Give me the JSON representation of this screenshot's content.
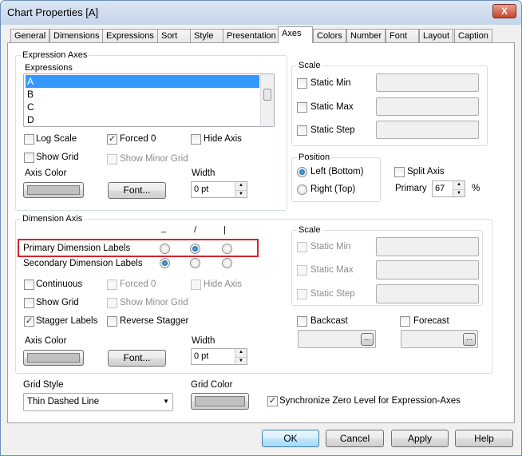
{
  "window": {
    "title": "Chart Properties [A]",
    "close": "X"
  },
  "tabs": [
    "General",
    "Dimensions",
    "Expressions",
    "Sort",
    "Style",
    "Presentation",
    "Axes",
    "Colors",
    "Number",
    "Font",
    "Layout",
    "Caption"
  ],
  "expression_axes": {
    "group_label": "Expression Axes",
    "list_label": "Expressions",
    "items": [
      "A",
      "B",
      "C",
      "D"
    ],
    "selected": "A",
    "log_scale": {
      "label": "Log Scale",
      "checked": false
    },
    "forced0": {
      "label": "Forced 0",
      "checked": true
    },
    "hide_axis": {
      "label": "Hide Axis",
      "checked": false
    },
    "show_grid": {
      "label": "Show Grid",
      "checked": false
    },
    "show_minor_grid": {
      "label": "Show Minor Grid",
      "checked": false,
      "disabled": true
    },
    "axis_color_label": "Axis Color",
    "font_button": "Font...",
    "width_label": "Width",
    "width_value": "0 pt",
    "scale": {
      "label": "Scale",
      "static_min": "Static Min",
      "static_max": "Static Max",
      "static_step": "Static Step"
    },
    "position": {
      "label": "Position",
      "left": "Left (Bottom)",
      "right": "Right (Top)",
      "selected": "left"
    },
    "split_axis": {
      "label": "Split Axis",
      "checked": false
    },
    "primary_label": "Primary",
    "primary_value": "67",
    "percent": "%"
  },
  "dimension_axis": {
    "group_label": "Dimension Axis",
    "orient_headers": [
      "_",
      "/",
      "|"
    ],
    "primary_labels": {
      "label": "Primary Dimension Labels",
      "selected": 1
    },
    "secondary_labels": {
      "label": "Secondary Dimension Labels",
      "selected": 0
    },
    "continuous": {
      "label": "Continuous",
      "checked": false
    },
    "forced0": {
      "label": "Forced 0",
      "disabled": true
    },
    "hide_axis": {
      "label": "Hide Axis",
      "disabled": true
    },
    "show_grid": {
      "label": "Show Grid",
      "checked": false
    },
    "show_minor_grid": {
      "label": "Show Minor Grid",
      "disabled": true
    },
    "stagger_labels": {
      "label": "Stagger Labels",
      "checked": true
    },
    "reverse_stagger": {
      "label": "Reverse Stagger",
      "checked": false
    },
    "axis_color_label": "Axis Color",
    "font_button": "Font...",
    "width_label": "Width",
    "width_value": "0 pt",
    "scale": {
      "label": "Scale",
      "static_min": "Static Min",
      "static_max": "Static Max",
      "static_step": "Static Step"
    },
    "backcast": "Backcast",
    "forecast": "Forecast",
    "ellipsis": "..."
  },
  "grid": {
    "style_label": "Grid Style",
    "style_value": "Thin Dashed Line",
    "color_label": "Grid Color",
    "sync_label": "Synchronize Zero Level for Expression-Axes",
    "sync_checked": true
  },
  "buttons": {
    "ok": "OK",
    "cancel": "Cancel",
    "apply": "Apply",
    "help": "Help"
  },
  "colors": {
    "highlight": "#d9222a",
    "selection": "#3399ff"
  }
}
